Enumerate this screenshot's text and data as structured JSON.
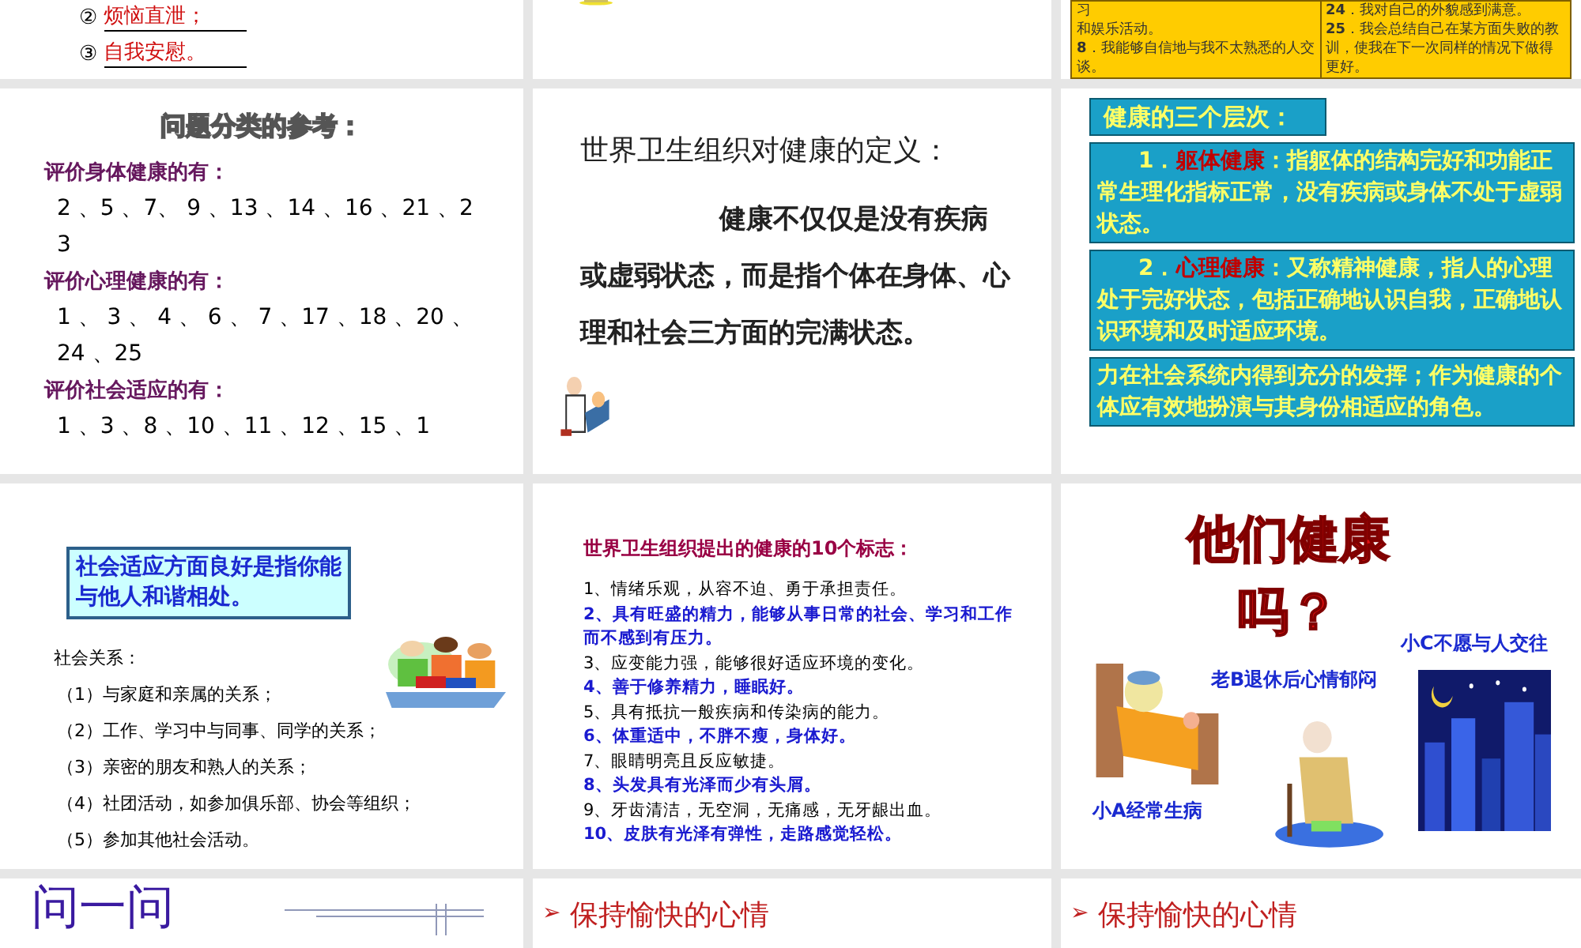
{
  "rows": [
    {
      "slides": [
        {
          "kind": "answers",
          "items": [
            {
              "marker": "②",
              "text": "烦恼直泄；"
            },
            {
              "marker": "③",
              "text": "自我安慰。"
            }
          ]
        },
        {
          "kind": "picture"
        },
        {
          "kind": "table",
          "left": [
            "习",
            "和娱乐活动。",
            "**8**．我能够自信地与我不太熟悉的人交谈。"
          ],
          "right": [
            "**24**．我对自己的外貌感到满意。",
            "**25**．我会总结自己在某方面失败的教训，使我在下一次同样的情况下做得更好。"
          ]
        }
      ]
    },
    {
      "slides": [
        {
          "kind": "classification",
          "title": "问题分类的参考：",
          "sections": [
            {
              "heading": "评价身体健康的有：",
              "numbers": "2 、5 、7、 9 、13 、14 、16 、21 、23"
            },
            {
              "heading": "评价心理健康的有：",
              "numbers": "1 、 3 、 4 、 6 、 7 、17 、18 、20 、24 、25"
            },
            {
              "heading": "评价社会适应的有：",
              "numbers": "1 、3 、8 、10 、11 、12 、15 、1"
            }
          ]
        },
        {
          "kind": "definition",
          "title": "世界卫生组织对健康的定义：",
          "body": "健康不仅仅是没有疾病或虚弱状态，而是指个体在**身体**、**心理**和**社会**三方面的完满状态。"
        },
        {
          "kind": "levels",
          "title": "健康的三个层次：",
          "items": [
            {
              "number": "1．",
              "term": "躯体健康",
              "text": "：指躯体的结构完好和功能正常生理化指标正常，没有疾病或身体不处于虚弱状态。"
            },
            {
              "number": "2．",
              "term": "心理健康",
              "text": "：又称精神健康，指人的心理处于完好状态，包括正确地认识自我，正确地认识环境和及时适应环境。"
            },
            {
              "text": "力在社会系统内得到充分的发挥；作为健康的个体应有效地扮演与其身份相适应的角色。"
            }
          ]
        }
      ]
    },
    {
      "slides": [
        {
          "kind": "social",
          "callout": "社会适应方面良好是指你能与他人和谐相处。",
          "label": "社会关系：",
          "items": [
            "（1）与家庭和亲属的关系；",
            "（2）工作、学习中与同事、同学的关系；",
            "（3）亲密的朋友和熟人的关系；",
            "（4）社团活动，如参加俱乐部、协会等组织；",
            "（5）参加其他社会活动。"
          ]
        },
        {
          "kind": "signs",
          "title": "世界卫生组织提出的健康的**10**个标志：",
          "items": [
            {
              "text": "1、情绪乐观，从容不迫、勇于承担责任。",
              "highlighted": false
            },
            {
              "text": "2、具有旺盛的精力，能够从事日常的社会、学习和工作而不感到有压力。",
              "highlighted": true
            },
            {
              "text": "3、应变能力强，能够很好适应环境的变化。",
              "highlighted": false
            },
            {
              "text": "4、善于修养精力，睡眠好。",
              "highlighted": true
            },
            {
              "text": "5、具有抵抗一般疾病和传染病的能力。",
              "highlighted": false
            },
            {
              "text": "6、体重适中，不胖不瘦，身体好。",
              "highlighted": true
            },
            {
              "text": "7、眼睛明亮且反应敏捷。",
              "highlighted": false
            },
            {
              "text": "8、头发具有光泽而少有头屑。",
              "highlighted": true
            },
            {
              "text": "9、牙齿清洁，无空洞，无痛感，无牙龈出血。",
              "highlighted": false
            },
            {
              "text": "10、皮肤有光泽有弹性，走路感觉轻松。",
              "highlighted": true
            }
          ]
        },
        {
          "kind": "question",
          "title": "他们健康吗？",
          "captions": [
            "小C不愿与人交往",
            "老B退休后心情郁闷",
            "小A经常生病"
          ]
        }
      ]
    },
    {
      "slides": [
        {
          "kind": "heading",
          "title": "问一问"
        },
        {
          "kind": "bullet",
          "bullet": "➢",
          "text": "保持愉快的心情"
        },
        {
          "kind": "bullet",
          "bullet": "➢",
          "text": "保持愉快的心情"
        }
      ]
    }
  ]
}
